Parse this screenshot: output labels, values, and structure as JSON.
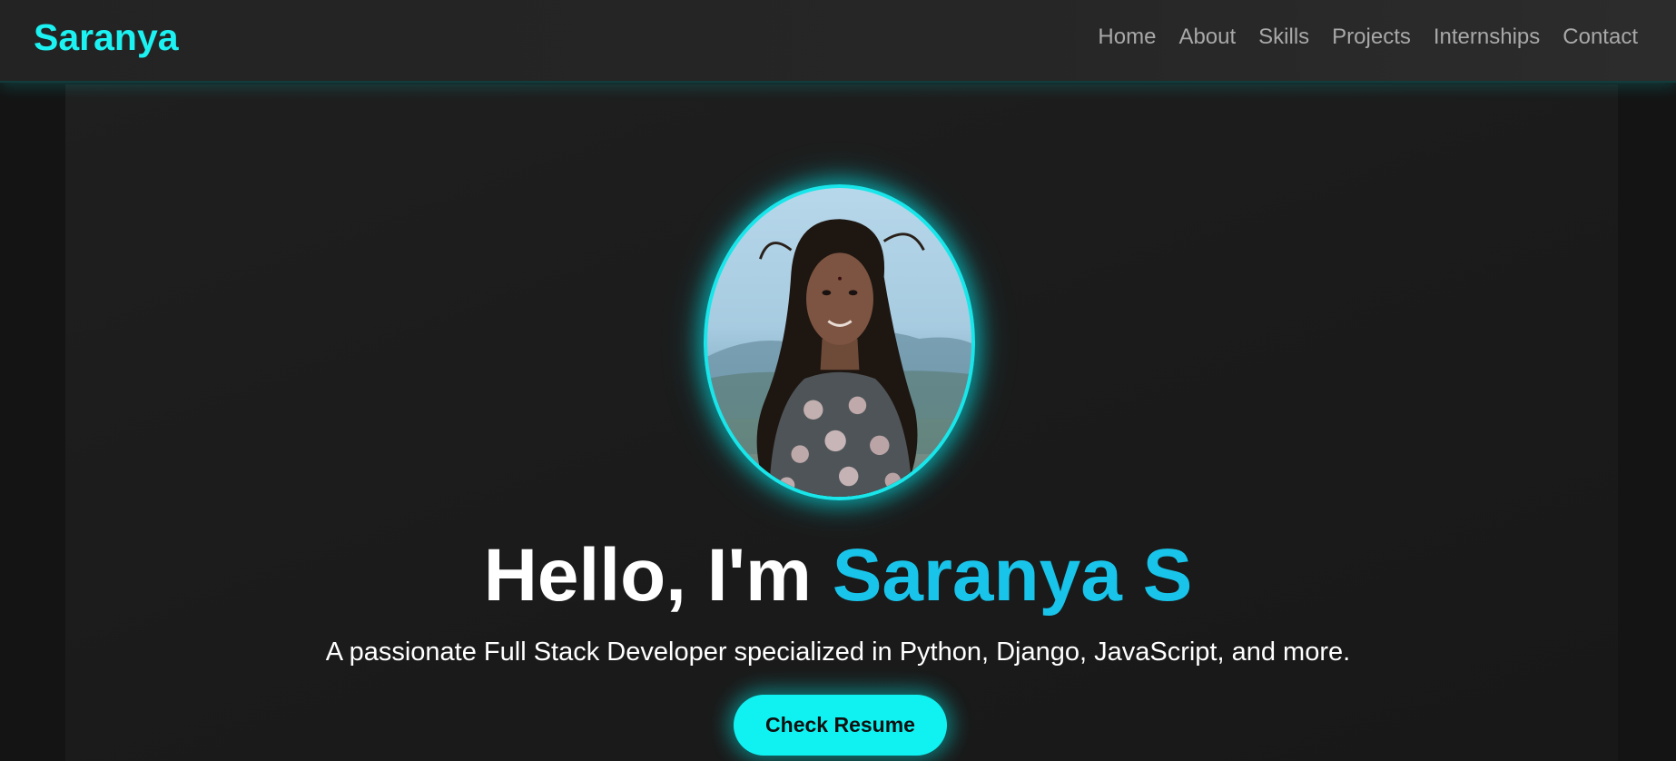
{
  "brand": {
    "name": "Saranya",
    "color": "#1cf2f2"
  },
  "nav": {
    "items": [
      {
        "label": "Home"
      },
      {
        "label": "About"
      },
      {
        "label": "Skills"
      },
      {
        "label": "Projects"
      },
      {
        "label": "Internships"
      },
      {
        "label": "Contact"
      }
    ]
  },
  "hero": {
    "greeting": "Hello, I'm ",
    "name": "Saranya S",
    "subtitle": "A passionate Full Stack Developer specialized in Python, Django, JavaScript, and more.",
    "button_label": "Check Resume",
    "avatar_alt": "profile-photo"
  },
  "colors": {
    "accent": "#10f2f2",
    "name_highlight": "#18c4ea",
    "background": "#1b1b1b",
    "nav_text": "#a8a8a8"
  }
}
